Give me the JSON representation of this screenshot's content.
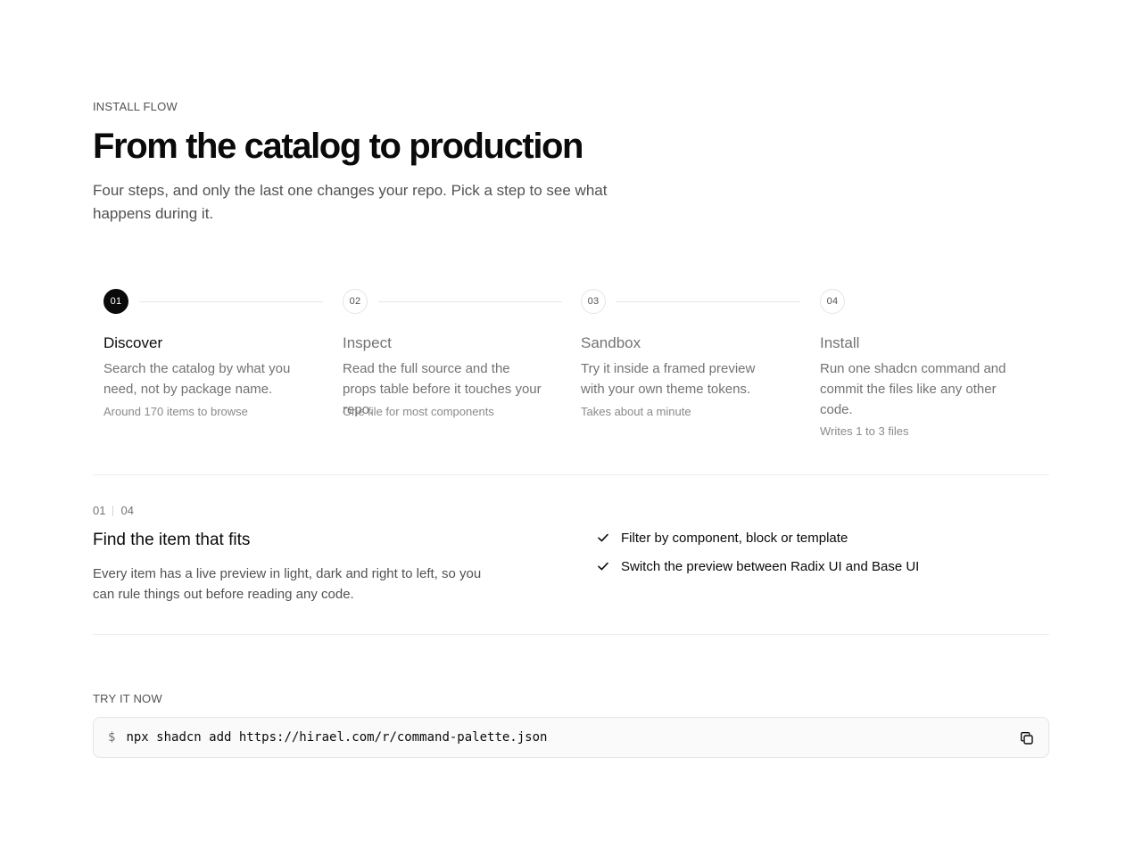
{
  "header": {
    "eyebrow": "INSTALL FLOW",
    "title": "From the catalog to production",
    "lede": "Four steps, and only the last one changes your repo. Pick a step to see what happens during it."
  },
  "steps": [
    {
      "number": "01",
      "title": "Discover",
      "description": "Search the catalog by what you need, not by package name.",
      "meta": "Around 170 items to browse",
      "active": true
    },
    {
      "number": "02",
      "title": "Inspect",
      "description": "Read the full source and the props table before it touches your repo.",
      "meta": "One file for most components",
      "active": false
    },
    {
      "number": "03",
      "title": "Sandbox",
      "description": "Try it inside a framed preview with your own theme tokens.",
      "meta": "Takes about a minute",
      "active": false
    },
    {
      "number": "04",
      "title": "Install",
      "description": "Run one shadcn command and commit the files like any other code.",
      "meta": "Writes 1 to 3 files",
      "active": false
    }
  ],
  "detail": {
    "current": "01",
    "total": "04",
    "title": "Find the item that fits",
    "description": "Every item has a live preview in light, dark and right to left, so you can rule things out before reading any code.",
    "features": [
      "Filter by component, block or template",
      "Switch the preview between Radix UI and Base UI"
    ]
  },
  "try": {
    "label": "TRY IT NOW",
    "prompt": "$",
    "command": "npx shadcn add https://hirael.com/r/command-palette.json",
    "copy_icon": "copy-icon"
  },
  "colors": {
    "accent": "#0a0a0a",
    "muted": "#737373",
    "border": "#e5e5e5"
  }
}
